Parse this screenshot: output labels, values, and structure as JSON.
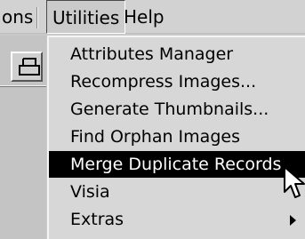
{
  "menubar": {
    "items": [
      {
        "label": "ons"
      },
      {
        "label": "Utilities"
      },
      {
        "label": "Help"
      }
    ]
  },
  "utilities_menu": {
    "items": [
      {
        "label": "Attributes Manager",
        "highlighted": false,
        "submenu": false
      },
      {
        "label": "Recompress Images...",
        "highlighted": false,
        "submenu": false
      },
      {
        "label": "Generate Thumbnails...",
        "highlighted": false,
        "submenu": false
      },
      {
        "label": "Find Orphan Images",
        "highlighted": false,
        "submenu": false
      },
      {
        "label": "Merge Duplicate Records",
        "highlighted": true,
        "submenu": false
      },
      {
        "label": "Visia",
        "highlighted": false,
        "submenu": false
      },
      {
        "label": "Extras",
        "highlighted": false,
        "submenu": true
      }
    ]
  },
  "icons": {
    "toolbar": "printer-icon",
    "submenu": "submenu-arrow-icon",
    "pointer": "mouse-cursor-icon"
  },
  "colors": {
    "highlight_bg": "#000000",
    "highlight_text": "#ffffff",
    "menu_bg": "#d7d7d7"
  }
}
